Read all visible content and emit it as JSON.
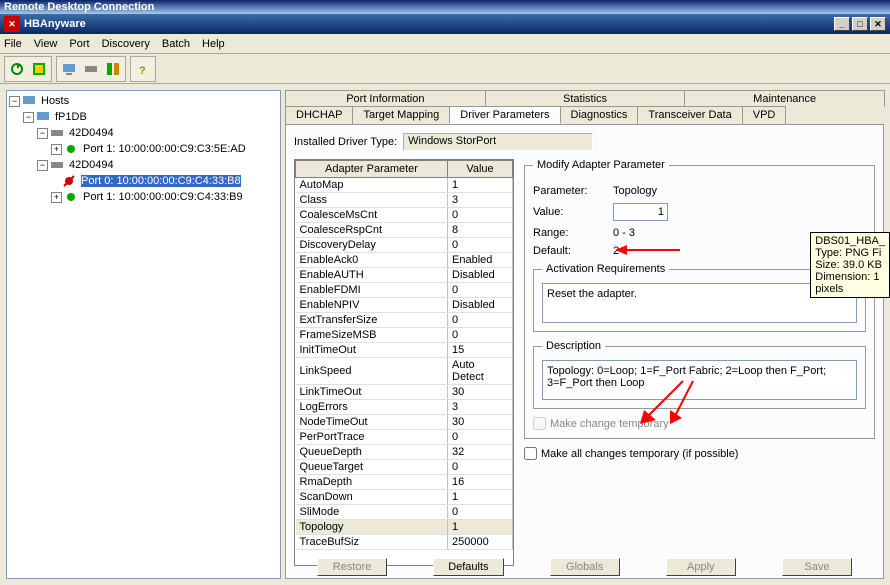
{
  "outer_title": "Remote Desktop Connection",
  "app_title": "HBAnyware",
  "menu": [
    "File",
    "View",
    "Port",
    "Discovery",
    "Batch",
    "Help"
  ],
  "toolbar_icons": [
    "refresh-icon",
    "reconnect-icon",
    "host-icon",
    "card-icon",
    "disk-icon",
    "help-icon"
  ],
  "tree": {
    "root": "Hosts",
    "host": "fP1DB",
    "adapter1": "42D0494",
    "port1a": "Port 1: 10:00:00:00:C9:C3:5E:AD",
    "adapter2": "42D0494",
    "port2a": "Port 0: 10:00:00:00:C9:C4:33:B8",
    "port2b": "Port 1: 10:00:00:00:C9:C4:33:B9"
  },
  "tabs_row1": [
    "Port Information",
    "Statistics",
    "Maintenance"
  ],
  "tabs_row2": [
    "DHCHAP",
    "Target Mapping",
    "Driver Parameters",
    "Diagnostics",
    "Transceiver Data",
    "VPD"
  ],
  "active_tab": "Driver Parameters",
  "installed_label": "Installed Driver Type:",
  "installed_value": "Windows StorPort",
  "param_headers": [
    "Adapter Parameter",
    "Value"
  ],
  "params": [
    {
      "n": "AutoMap",
      "v": "1"
    },
    {
      "n": "Class",
      "v": "3"
    },
    {
      "n": "CoalesceMsCnt",
      "v": "0"
    },
    {
      "n": "CoalesceRspCnt",
      "v": "8"
    },
    {
      "n": "DiscoveryDelay",
      "v": "0"
    },
    {
      "n": "EnableAck0",
      "v": "Enabled"
    },
    {
      "n": "EnableAUTH",
      "v": "Disabled"
    },
    {
      "n": "EnableFDMI",
      "v": "0"
    },
    {
      "n": "EnableNPIV",
      "v": "Disabled"
    },
    {
      "n": "ExtTransferSize",
      "v": "0"
    },
    {
      "n": "FrameSizeMSB",
      "v": "0"
    },
    {
      "n": "InitTimeOut",
      "v": "15"
    },
    {
      "n": "LinkSpeed",
      "v": "Auto Detect"
    },
    {
      "n": "LinkTimeOut",
      "v": "30"
    },
    {
      "n": "LogErrors",
      "v": "3"
    },
    {
      "n": "NodeTimeOut",
      "v": "30"
    },
    {
      "n": "PerPortTrace",
      "v": "0"
    },
    {
      "n": "QueueDepth",
      "v": "32"
    },
    {
      "n": "QueueTarget",
      "v": "0"
    },
    {
      "n": "RmaDepth",
      "v": "16"
    },
    {
      "n": "ScanDown",
      "v": "1"
    },
    {
      "n": "SliMode",
      "v": "0"
    },
    {
      "n": "Topology",
      "v": "1",
      "hl": true
    },
    {
      "n": "TraceBufSiz",
      "v": "250000"
    }
  ],
  "modify": {
    "legend": "Modify Adapter Parameter",
    "param_label": "Parameter:",
    "param_value": "Topology",
    "value_label": "Value:",
    "value_value": "1",
    "range_label": "Range:",
    "range_value": "0 - 3",
    "default_label": "Default:",
    "default_value": "2",
    "activation_legend": "Activation Requirements",
    "activation_text": "Reset the adapter.",
    "description_legend": "Description",
    "description_text": "Topology: 0=Loop; 1=F_Port Fabric; 2=Loop then F_Port; 3=F_Port then Loop",
    "temp_label": "Make change temporary",
    "all_temp_label": "Make all changes temporary (if possible)"
  },
  "buttons": [
    "Restore",
    "Defaults",
    "Globals",
    "Apply",
    "Save"
  ],
  "tooltip": {
    "l1": "DBS01_HBA_",
    "l2": "Type: PNG Fi",
    "l3": "Size: 39.0 KB",
    "l4": "Dimension: 1",
    "l5": "pixels"
  },
  "colors": {
    "accent": "#316ac5",
    "red": "#ff0000"
  }
}
